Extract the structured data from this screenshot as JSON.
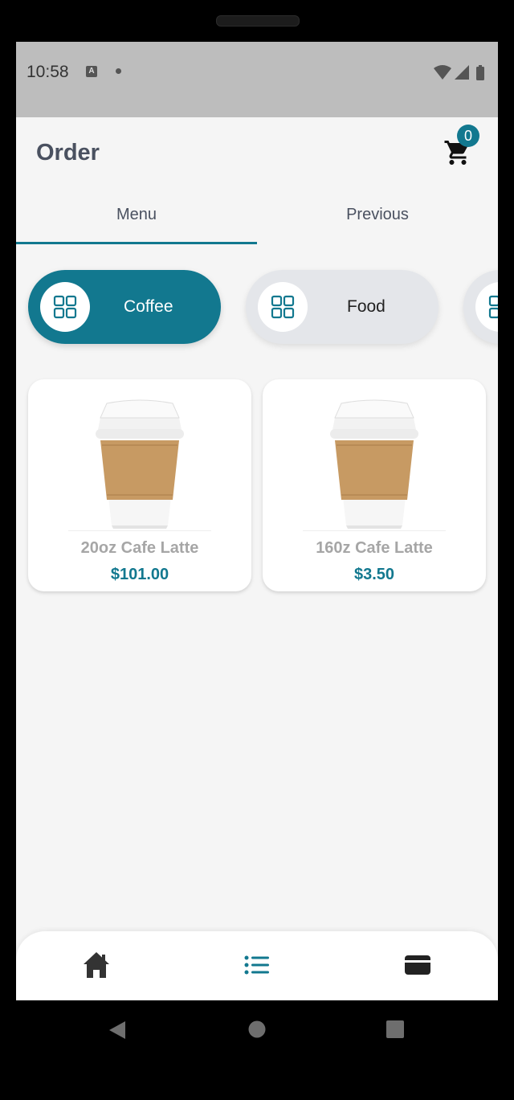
{
  "status_bar": {
    "time": "10:58",
    "notification_icon": "A"
  },
  "app_bar": {
    "title": "Order",
    "cart_count": "0"
  },
  "tabs": [
    {
      "label": "Menu",
      "active": true
    },
    {
      "label": "Previous",
      "active": false
    }
  ],
  "categories": [
    {
      "label": "Coffee",
      "selected": true,
      "icon": "grid-icon"
    },
    {
      "label": "Food",
      "selected": false,
      "icon": "grid-icon"
    },
    {
      "label": "",
      "selected": false,
      "icon": "grid-icon"
    }
  ],
  "products": [
    {
      "name": "20oz Cafe Latte",
      "price": "$101.00",
      "image": "coffee-cup-image"
    },
    {
      "name": "160z Cafe Latte",
      "price": "$3.50",
      "image": "coffee-cup-image"
    }
  ],
  "bottom_nav": {
    "icons": [
      "home-icon",
      "list-icon",
      "card-icon"
    ],
    "active": "list-icon"
  },
  "colors": {
    "accent": "#12788f",
    "title": "#4a5160",
    "chip_inactive": "#e4e6ea",
    "price": "#12788f"
  }
}
